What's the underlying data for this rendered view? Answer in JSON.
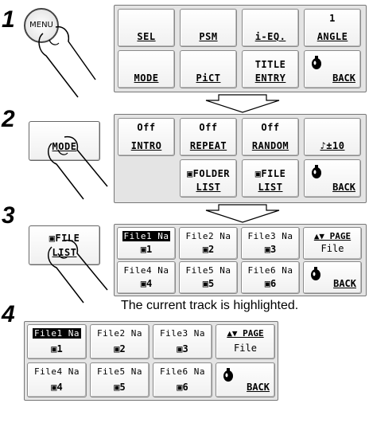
{
  "steps": [
    "1",
    "2",
    "3",
    "4"
  ],
  "step1": {
    "menu_button_label": "MENU",
    "keys": [
      {
        "top": "",
        "bottom": "SEL"
      },
      {
        "top": "",
        "bottom": "PSM"
      },
      {
        "top": "",
        "bottom": "i-EQ."
      },
      {
        "top": "1",
        "bottom": "ANGLE"
      },
      {
        "top": "",
        "bottom": "MODE"
      },
      {
        "top": "",
        "bottom": "PiCT"
      },
      {
        "top": "TITLE",
        "bottom": "ENTRY"
      }
    ],
    "back_label": "BACK"
  },
  "step2": {
    "mode_button_label": "MODE",
    "keys": [
      {
        "top": "Off",
        "bottom": "INTRO"
      },
      {
        "top": "Off",
        "bottom": "REPEAT"
      },
      {
        "top": "Off",
        "bottom": "RANDOM"
      },
      {
        "top": "",
        "bottom": "♪±10"
      },
      {
        "top": "▣FOLDER",
        "bottom": "LIST"
      },
      {
        "top": "▣FILE",
        "bottom": "LIST"
      }
    ],
    "back_label": "BACK"
  },
  "step3": {
    "file_list_button_top": "▣FILE",
    "file_list_button_bottom": "LIST",
    "files": [
      {
        "name": "File1 Na",
        "num": "▣1",
        "highlight": true
      },
      {
        "name": "File2 Na",
        "num": "▣2",
        "highlight": false
      },
      {
        "name": "File3 Na",
        "num": "▣3",
        "highlight": false
      },
      {
        "name": "File4 Na",
        "num": "▣4",
        "highlight": false
      },
      {
        "name": "File5 Na",
        "num": "▣5",
        "highlight": false
      },
      {
        "name": "File6 Na",
        "num": "▣6",
        "highlight": false
      }
    ],
    "page_label": "▲▼ PAGE",
    "page_sub": "File",
    "back_label": "BACK"
  },
  "caption": "The current track is highlighted.",
  "step4": {
    "files": [
      {
        "name": "File1 Na",
        "num": "▣1",
        "highlight": true
      },
      {
        "name": "File2 Na",
        "num": "▣2",
        "highlight": false
      },
      {
        "name": "File3 Na",
        "num": "▣3",
        "highlight": false
      },
      {
        "name": "File4 Na",
        "num": "▣4",
        "highlight": false
      },
      {
        "name": "File5 Na",
        "num": "▣5",
        "highlight": false
      },
      {
        "name": "File6 Na",
        "num": "▣6",
        "highlight": false
      }
    ],
    "page_label": "▲▼ PAGE",
    "page_sub": "File",
    "back_label": "BACK"
  }
}
